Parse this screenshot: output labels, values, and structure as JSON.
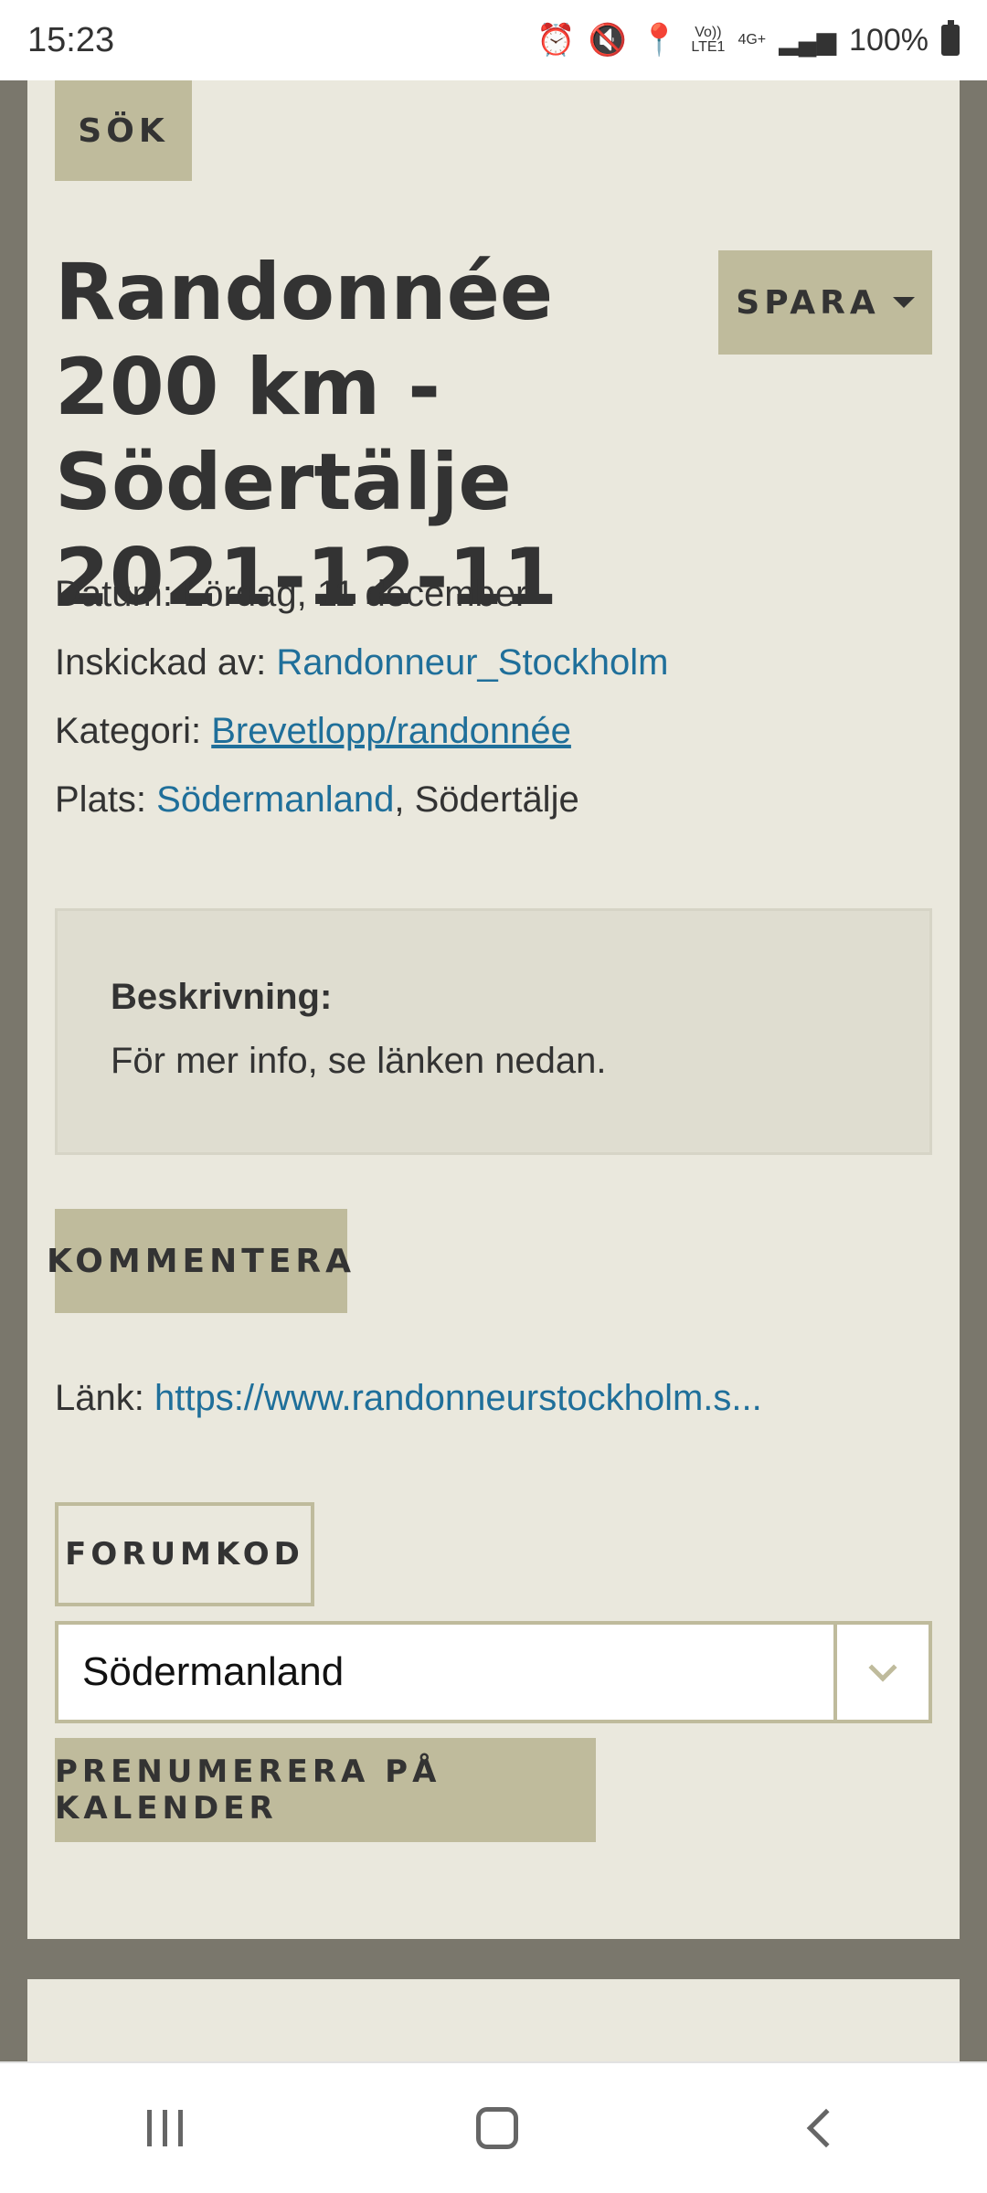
{
  "status_bar": {
    "time": "15:23",
    "network_top": "Vo))",
    "network_bottom": "LTE1",
    "net_type": "4G+",
    "battery": "100%"
  },
  "search_button": "SÖK",
  "event": {
    "title": "Randonnée 200 km - Södertälje 2021-12-11",
    "save_button": "SPARA",
    "date_label": "Datum:",
    "date_value": "Lördag, 11 december",
    "submitted_label": "Inskickad av:",
    "submitted_value": "Randonneur_Stockholm",
    "category_label": "Kategori:",
    "category_value": "Brevetlopp/randonnée",
    "place_label": "Plats:",
    "place_region": "Södermanland",
    "place_city": ", Södertälje",
    "description_label": "Beskrivning:",
    "description_text": "För mer info, se länken nedan.",
    "comment_button": "KOMMENTERA",
    "link_label": "Länk:",
    "link_value": "https://www.randonneurstockholm.s...",
    "forumcode_button": "FORUMKOD",
    "region_select": "Södermanland",
    "subscribe_button": "PRENUMERERA PÅ KALENDER"
  },
  "colors": {
    "background": "#7a776c",
    "card": "#eae8dd",
    "button": "#bfbb9c",
    "link": "#1f6f9a"
  }
}
